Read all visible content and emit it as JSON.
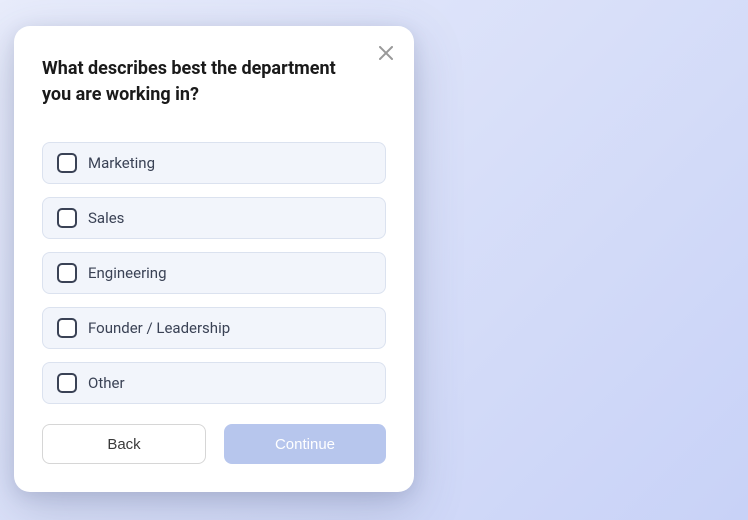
{
  "prompt": {
    "title": "What describes best the department you are working in?"
  },
  "options": [
    {
      "label": "Marketing"
    },
    {
      "label": "Sales"
    },
    {
      "label": "Engineering"
    },
    {
      "label": "Founder / Leadership"
    },
    {
      "label": "Other"
    }
  ],
  "footer": {
    "back_label": "Back",
    "continue_label": "Continue"
  }
}
